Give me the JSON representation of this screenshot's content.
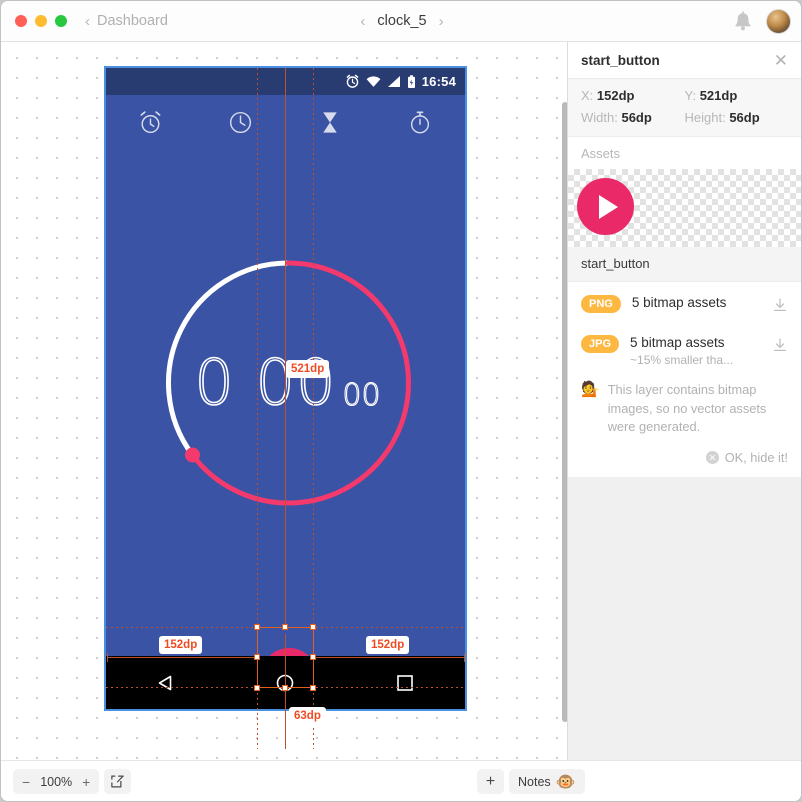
{
  "titlebar": {
    "breadcrumb": "Dashboard",
    "doc_title": "clock_5",
    "prev_icon": "chevron-left-icon",
    "next_icon": "chevron-right-icon",
    "bell_icon": "bell-icon",
    "avatar": "user-avatar"
  },
  "artboard": {
    "status_time": "16:54",
    "status_icons": [
      "alarm-icon",
      "wifi-icon",
      "signal-icon",
      "battery-icon"
    ],
    "tabs": [
      "alarm-tab-icon",
      "clock-tab-icon",
      "hourglass-tab-icon",
      "stopwatch-tab-icon"
    ],
    "timer": {
      "main": "0 00",
      "centis": "00"
    },
    "fab": "play-button",
    "nav": [
      "back-icon",
      "home-icon",
      "recents-icon"
    ]
  },
  "measurements": {
    "left": "152dp",
    "right": "152dp",
    "vertical": "521dp",
    "bottom": "63dp"
  },
  "panel": {
    "title": "start_button",
    "close_icon": "close-icon",
    "props": {
      "x_label": "X:",
      "x_value": "152dp",
      "y_label": "Y:",
      "y_value": "521dp",
      "w_label": "Width:",
      "w_value": "56dp",
      "h_label": "Height:",
      "h_value": "56dp"
    },
    "assets_label": "Assets",
    "asset_name": "start_button",
    "assets": [
      {
        "format": "PNG",
        "main": "5 bitmap assets",
        "sub": ""
      },
      {
        "format": "JPG",
        "main": "5 bitmap assets",
        "sub": "~15% smaller tha..."
      }
    ],
    "note": {
      "emoji": "💁",
      "text": "This layer contains bitmap images, so no vector assets were generated.",
      "hide_label": "OK, hide it!"
    }
  },
  "bottombar": {
    "zoom_out": "−",
    "zoom_value": "100%",
    "zoom_in": "+",
    "expand_icon": "expand-icon",
    "add_label": "+",
    "notes_label": "Notes",
    "notes_emoji": "🐵"
  },
  "colors": {
    "accent_pink": "#ea2a68",
    "app_blue": "#3a53a4",
    "status_blue": "#283c72",
    "measure_orange": "#ef4b23",
    "badge_orange": "#fdb842"
  }
}
